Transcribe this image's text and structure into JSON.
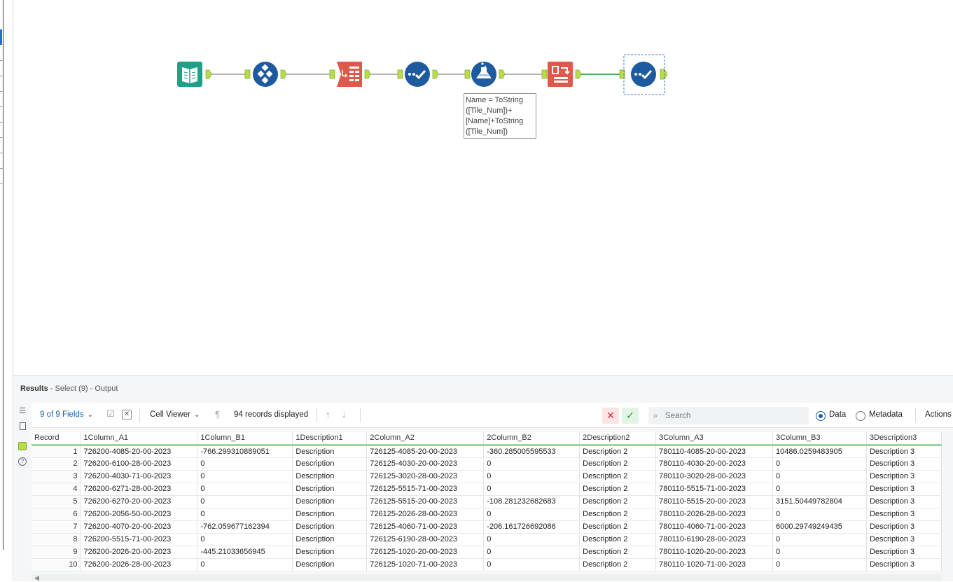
{
  "canvas": {
    "annotation_lines": [
      "Name = ToString",
      "([Tile_Num])+",
      "[Name]+ToString",
      "([Tile_Num])"
    ],
    "tools": [
      {
        "name": "input-data-tool",
        "icon": "book-icon",
        "color": "#1ea187"
      },
      {
        "name": "sample-tool",
        "icon": "diamond-grid-icon",
        "color": "#1e5aa0"
      },
      {
        "name": "crosstab-tool",
        "icon": "crosstab-icon",
        "color": "#e0584a"
      },
      {
        "name": "select-tool",
        "icon": "check-dots-icon",
        "color": "#1e5aa0"
      },
      {
        "name": "formula-tool",
        "icon": "flask-icon",
        "color": "#1e5aa0"
      },
      {
        "name": "transpose-tool",
        "icon": "transpose-icon",
        "color": "#e0584a"
      },
      {
        "name": "select-tool-selected",
        "icon": "check-dots-icon",
        "color": "#1e5aa0"
      }
    ]
  },
  "results": {
    "title_bold": "Results",
    "title_rest": " - Select (9) - Output",
    "toolbar": {
      "fields_label": "9 of 9 Fields",
      "cell_viewer_label": "Cell Viewer",
      "records_label": "94 records displayed",
      "search_placeholder": "Search",
      "data_label": "Data",
      "metadata_label": "Metadata",
      "actions_label": "Actions"
    },
    "columns": [
      "Record",
      "1Column_A1",
      "1Column_B1",
      "1Description1",
      "2Column_A2",
      "2Column_B2",
      "2Description2",
      "3Column_A3",
      "3Column_B3",
      "3Description3"
    ],
    "rows": [
      [
        "1",
        "726200-4085-20-00-2023",
        "-766.299310889051",
        "Description",
        "726125-4085-20-00-2023",
        "-360.285005595533",
        "Description 2",
        "780110-4085-20-00-2023",
        "10486.0259483905",
        "Description 3"
      ],
      [
        "2",
        "726200-6100-28-00-2023",
        "0",
        "Description",
        "726125-4030-20-00-2023",
        "0",
        "Description 2",
        "780110-4030-20-00-2023",
        "0",
        "Description 3"
      ],
      [
        "3",
        "726200-4030-71-00-2023",
        "0",
        "Description",
        "726125-3020-28-00-2023",
        "0",
        "Description 2",
        "780110-3020-28-00-2023",
        "0",
        "Description 3"
      ],
      [
        "4",
        "726200-6271-28-00-2023",
        "0",
        "Description",
        "726125-5515-71-00-2023",
        "0",
        "Description 2",
        "780110-5515-71-00-2023",
        "0",
        "Description 3"
      ],
      [
        "5",
        "726200-6270-20-00-2023",
        "0",
        "Description",
        "726125-5515-20-00-2023",
        "-108.281232682683",
        "Description 2",
        "780110-5515-20-00-2023",
        "3151.50449782804",
        "Description 3"
      ],
      [
        "6",
        "726200-2056-50-00-2023",
        "0",
        "Description",
        "726125-2026-28-00-2023",
        "0",
        "Description 2",
        "780110-2026-28-00-2023",
        "0",
        "Description 3"
      ],
      [
        "7",
        "726200-4070-20-00-2023",
        "-762.059677162394",
        "Description",
        "726125-4060-71-00-2023",
        "-206.161726692086",
        "Description 2",
        "780110-4060-71-00-2023",
        "6000.29749249435",
        "Description 3"
      ],
      [
        "8",
        "726200-5515-71-00-2023",
        "0",
        "Description",
        "726125-6190-28-00-2023",
        "0",
        "Description 2",
        "780110-6190-28-00-2023",
        "0",
        "Description 3"
      ],
      [
        "9",
        "726200-2026-20-00-2023",
        "-445.21033656945",
        "Description",
        "726125-1020-20-00-2023",
        "0",
        "Description 2",
        "780110-1020-20-00-2023",
        "0",
        "Description 3"
      ],
      [
        "10",
        "726200-2026-28-00-2023",
        "0",
        "Description",
        "726125-1020-71-00-2023",
        "0",
        "Description 2",
        "780110-1020-71-00-2023",
        "0",
        "Description 3"
      ]
    ]
  }
}
